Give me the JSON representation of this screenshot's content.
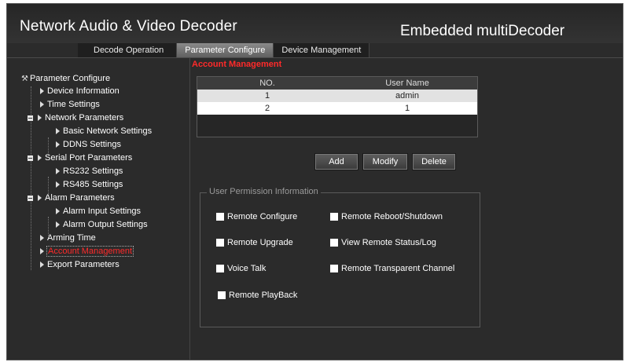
{
  "header": {
    "title": "Network Audio & Video Decoder",
    "product": "Embedded multiDecoder"
  },
  "tabs": [
    {
      "label": "Decode Operation"
    },
    {
      "label": "Parameter Configure"
    },
    {
      "label": "Device Management"
    }
  ],
  "sidebar": {
    "root": "Parameter Configure",
    "items": [
      "Device Information",
      "Time Settings",
      "Network Parameters",
      "Basic Network Settings",
      "DDNS Settings",
      "Serial Port Parameters",
      "RS232 Settings",
      "RS485 Settings",
      "Alarm Parameters",
      "Alarm Input Settings",
      "Alarm Output Settings",
      "Arming Time",
      "Account Management",
      "Export Parameters"
    ]
  },
  "main": {
    "section_title": "Account Management",
    "table": {
      "headers": [
        "NO.",
        "User Name"
      ],
      "rows": [
        [
          "1",
          "admin"
        ],
        [
          "2",
          "1"
        ]
      ]
    },
    "buttons": {
      "add": "Add",
      "modify": "Modify",
      "delete": "Delete"
    },
    "permissions": {
      "legend": "User Permission Information",
      "items": [
        "Remote Configure",
        "Remote Reboot/Shutdown",
        "Remote Upgrade",
        "View Remote Status/Log",
        "Voice Talk",
        "Remote Transparent Channel",
        "Remote PlayBack"
      ]
    }
  },
  "colors": {
    "background": "#2b2b2b",
    "accent_red": "#ff2a2a",
    "text": "#ffffff"
  }
}
